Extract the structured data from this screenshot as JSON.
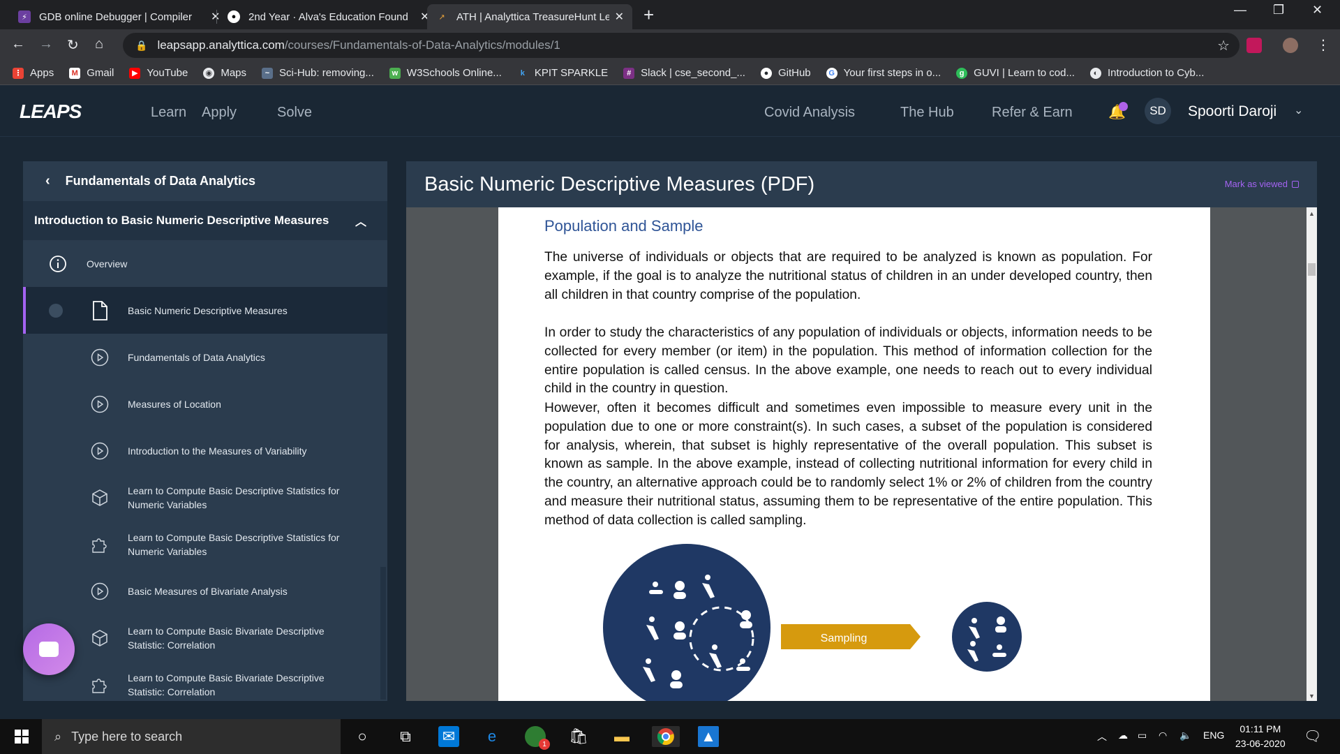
{
  "browser": {
    "tabs": [
      {
        "title": "GDB online Debugger | Compiler",
        "active": false
      },
      {
        "title": "2nd Year · Alva's Education Found",
        "active": false
      },
      {
        "title": "ATH | Analyttica TreasureHunt Le",
        "active": true
      }
    ],
    "url_host": "leapsapp.analyttica.com",
    "url_path": "/courses/Fundamentals-of-Data-Analytics/modules/1",
    "bookmarks": [
      {
        "label": "Apps",
        "icon": "apps-grid-icon",
        "color": "#ea4335"
      },
      {
        "label": "Gmail",
        "icon": "gmail-icon",
        "color": "#d93025"
      },
      {
        "label": "YouTube",
        "icon": "youtube-icon",
        "color": "#ff0000"
      },
      {
        "label": "Maps",
        "icon": "maps-icon",
        "color": "#5f6368"
      },
      {
        "label": "Sci-Hub: removing...",
        "icon": "scihub-icon",
        "color": "#5a6f8a"
      },
      {
        "label": "W3Schools Online...",
        "icon": "w3schools-icon",
        "color": "#4caf50"
      },
      {
        "label": "KPIT SPARKLE",
        "icon": "kpit-icon",
        "color": "#1565c0"
      },
      {
        "label": "Slack | cse_second_...",
        "icon": "slack-icon",
        "color": "#7c3085"
      },
      {
        "label": "GitHub",
        "icon": "github-icon",
        "color": "#24292e"
      },
      {
        "label": "Your first steps in o...",
        "icon": "google-icon",
        "color": "#4285f4"
      },
      {
        "label": "GUVI | Learn to cod...",
        "icon": "guvi-icon",
        "color": "#2ebd59"
      },
      {
        "label": "Introduction to Cyb...",
        "icon": "globe-icon",
        "color": "#5f6368"
      }
    ]
  },
  "site": {
    "logo": "LEAPS",
    "nav_left": [
      "Learn",
      "Apply",
      "Solve"
    ],
    "nav_right": [
      "Covid Analysis",
      "The Hub",
      "Refer & Earn"
    ],
    "user_initials": "SD",
    "user_name": "Spoorti Daroji",
    "accent": "#a463f2"
  },
  "sidebar": {
    "course_title": "Fundamentals of Data Analytics",
    "module_title": "Introduction to Basic Numeric Descriptive Measures",
    "items": [
      {
        "label": "Overview",
        "icon": "info-icon"
      },
      {
        "label": "Basic Numeric Descriptive Measures",
        "icon": "document-icon",
        "active": true
      },
      {
        "label": "Fundamentals of Data Analytics",
        "icon": "play-circle-icon"
      },
      {
        "label": "Measures of Location",
        "icon": "play-circle-icon"
      },
      {
        "label": "Introduction to the Measures of Variability",
        "icon": "play-circle-icon"
      },
      {
        "label": "Learn to Compute Basic Descriptive Statistics for Numeric Variables",
        "icon": "cube-icon"
      },
      {
        "label": "Learn to Compute Basic Descriptive Statistics for Numeric Variables",
        "icon": "puzzle-icon"
      },
      {
        "label": "Basic Measures of Bivariate Analysis",
        "icon": "play-circle-icon"
      },
      {
        "label": "Learn to Compute Basic Bivariate Descriptive Statistic: Correlation",
        "icon": "cube-icon"
      },
      {
        "label": "Learn to Compute Basic Bivariate Descriptive Statistic: Correlation",
        "icon": "puzzle-icon"
      }
    ]
  },
  "content": {
    "title": "Basic Numeric Descriptive Measures (PDF)",
    "mark_viewed": "Mark as viewed",
    "pdf_heading": "Population and Sample",
    "paragraphs": [
      "The universe of individuals or objects that are required to be analyzed is known as population. For example, if the goal is to analyze the nutritional status of children in an under developed country, then all children in that country comprise of the population.",
      "In order to study the characteristics of any population of individuals or objects, information needs to be collected for every member (or item) in the population. This method of information collection for the entire population is called census. In the above example, one needs to reach out to every individual child in the country in question.",
      "However, often it becomes difficult and sometimes even impossible to measure every unit in the population due to one or more constraint(s). In such cases, a subset of the population is considered for analysis, wherein, that subset is highly representative of the overall population. This subset is known as sample. In the above example, instead of collecting nutritional information for every child in the country, an alternative approach could be to randomly select 1% or 2% of children from the country and measure their nutritional status, assuming them to be representative of the entire population. This method of data collection is called sampling."
    ],
    "diagram_label": "Sampling",
    "diagram_colors": {
      "circle": "#1f3864",
      "arrow": "#d69a0e"
    }
  },
  "taskbar": {
    "search_placeholder": "Type here to search",
    "language": "ENG",
    "time": "01:11 PM",
    "date": "23-06-2020",
    "badge": "1"
  }
}
